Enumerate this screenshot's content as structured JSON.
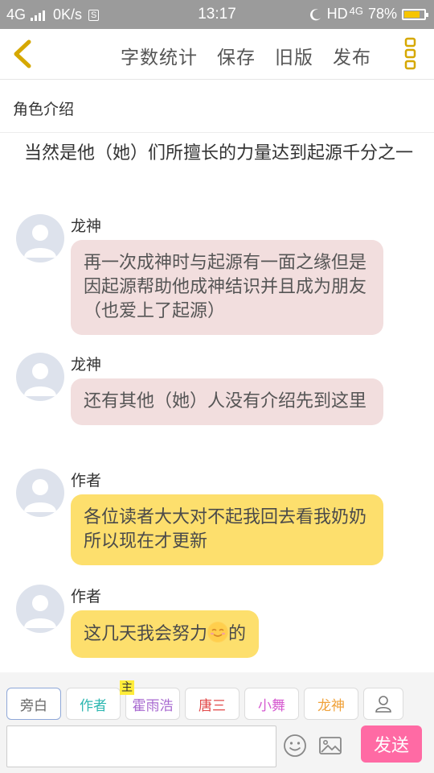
{
  "status_bar": {
    "signal": "4G",
    "speed": "0K/s",
    "time": "13:17",
    "hd": "HD",
    "net": "4G",
    "battery": "78%",
    "battery_level": 0.78
  },
  "navbar": {
    "actions": [
      "字数统计",
      "保存",
      "旧版",
      "发布"
    ]
  },
  "section_title": "角色介绍",
  "narration": "当然是他（她）们所擅长的力量达到起源千分之一",
  "messages": [
    {
      "sender": "龙神",
      "text": "再一次成神时与起源有一面之缘但是因起源帮助他成神结识并且成为朋友（也爱上了起源）"
    },
    {
      "sender": "龙神",
      "text": "还有其他（她）人没有介绍先到这里"
    },
    {
      "sender": "作者",
      "text": "各位读者大大对不起我回去看我奶奶所以现在才更新"
    },
    {
      "sender": "作者",
      "text_before": "这几天我会努力",
      "emoji": "smile-emoji",
      "text_after": "的"
    }
  ],
  "role_tabs": [
    {
      "label": "旁白",
      "color": "#666666"
    },
    {
      "label": "作者",
      "color": "#2eb7b1"
    },
    {
      "label": "霍雨浩",
      "color": "#a86ad0",
      "tag": "主"
    },
    {
      "label": "唐三",
      "color": "#e24848"
    },
    {
      "label": "小舞",
      "color": "#d65ad0"
    },
    {
      "label": "龙神",
      "color": "#f0a23a"
    }
  ],
  "input": {
    "value": ""
  },
  "send_label": "发送",
  "colors": {
    "accent_yellow": "#f6c500",
    "bubble_pink": "#f2dede",
    "bubble_yellow": "#fddf6d",
    "send": "#ff6aa4"
  }
}
